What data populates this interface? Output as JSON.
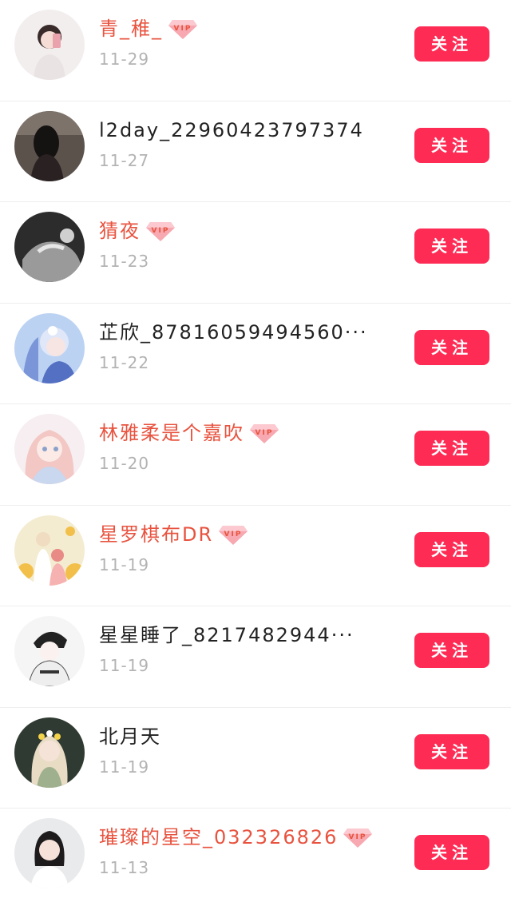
{
  "follow_label": "关注",
  "colors": {
    "vip_name": "#e8533f",
    "plain_name": "#222222",
    "follow_bg": "#fe2c55",
    "date": "#b3b3b3"
  },
  "users": [
    {
      "name": "青_稚_",
      "date": "11-29",
      "vip": true,
      "avatar": "avatar-girl-selfie"
    },
    {
      "name": "l2day_22960423797374",
      "date": "11-27",
      "vip": false,
      "avatar": "avatar-dark-photo"
    },
    {
      "name": "猜夜",
      "date": "11-23",
      "vip": true,
      "avatar": "avatar-monochrome"
    },
    {
      "name": "芷欣_87816059494560···",
      "date": "11-22",
      "vip": false,
      "avatar": "avatar-blue-anime"
    },
    {
      "name": "林雅柔是个嘉吹",
      "date": "11-20",
      "vip": true,
      "avatar": "avatar-pink-anime"
    },
    {
      "name": "星罗棋布DR",
      "date": "11-19",
      "vip": true,
      "avatar": "avatar-couple-flowers"
    },
    {
      "name": "星星睡了_8217482944···",
      "date": "11-19",
      "vip": false,
      "avatar": "avatar-sketch-girl"
    },
    {
      "name": "北月天",
      "date": "11-19",
      "vip": false,
      "avatar": "avatar-flower-crown"
    },
    {
      "name": "璀璨的星空_032326826",
      "date": "11-13",
      "vip": true,
      "avatar": "avatar-woman-photo"
    }
  ]
}
